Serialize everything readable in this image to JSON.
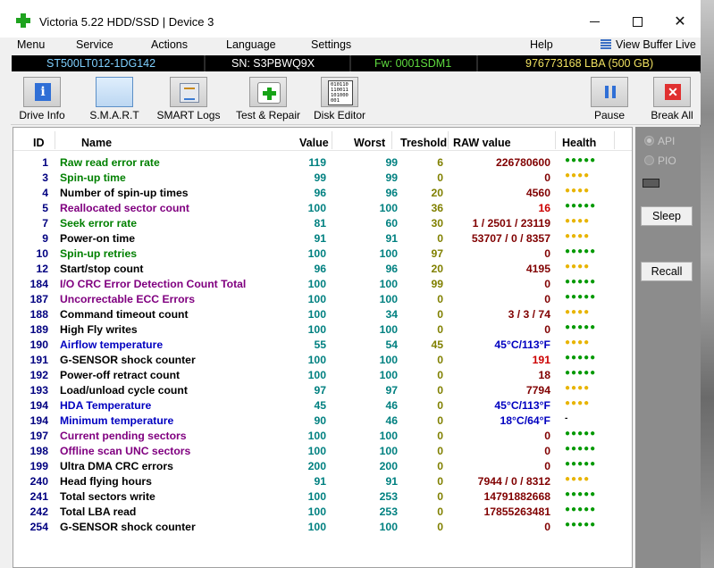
{
  "window": {
    "title": "Victoria 5.22 HDD/SSD | Device 3"
  },
  "colors": {
    "green": "#008000",
    "purple": "#800080",
    "blue": "#0000c0",
    "black": "#000000",
    "darkred": "#800000",
    "red": "#cc0000",
    "health_green": "#009900",
    "health_yellow": "#e8b400"
  },
  "menu": {
    "items": [
      "Menu",
      "Service",
      "Actions",
      "Language",
      "Settings",
      "Help"
    ],
    "view_buffer": "View Buffer Live"
  },
  "infobar": {
    "model": "ST500LT012-1DG142",
    "serial": "SN: S3PBWQ9X",
    "firmware": "Fw: 0001SDM1",
    "capacity": "976773168 LBA (500 GB)"
  },
  "toolbar": {
    "drive_info": "Drive Info",
    "smart": "S.M.A.R.T",
    "smart_logs": "SMART Logs",
    "test_repair": "Test & Repair",
    "disk_editor": "Disk Editor",
    "pause": "Pause",
    "break_all": "Break All",
    "editor_icon_text": "010110 110011 101000 001"
  },
  "table": {
    "headers": {
      "id": "ID",
      "name": "Name",
      "value": "Value",
      "worst": "Worst",
      "threshold": "Treshold",
      "raw": "RAW value",
      "health": "Health"
    },
    "rows": [
      {
        "id": "1",
        "name": "Raw read error rate",
        "name_color": "green",
        "value": "119",
        "worst": "99",
        "threshold": "6",
        "raw": "226780600",
        "raw_color": "darkred",
        "health": "●●●●●",
        "health_color": "health_green"
      },
      {
        "id": "3",
        "name": "Spin-up time",
        "name_color": "green",
        "value": "99",
        "worst": "99",
        "threshold": "0",
        "raw": "0",
        "raw_color": "darkred",
        "health": "●●●●",
        "health_color": "health_yellow"
      },
      {
        "id": "4",
        "name": "Number of spin-up times",
        "name_color": "black",
        "value": "96",
        "worst": "96",
        "threshold": "20",
        "raw": "4560",
        "raw_color": "darkred",
        "health": "●●●●",
        "health_color": "health_yellow"
      },
      {
        "id": "5",
        "name": "Reallocated sector count",
        "name_color": "purple",
        "value": "100",
        "worst": "100",
        "threshold": "36",
        "raw": "16",
        "raw_color": "red",
        "health": "●●●●●",
        "health_color": "health_green"
      },
      {
        "id": "7",
        "name": "Seek error rate",
        "name_color": "green",
        "value": "81",
        "worst": "60",
        "threshold": "30",
        "raw": "1 / 2501 / 23119",
        "raw_color": "darkred",
        "health": "●●●●",
        "health_color": "health_yellow"
      },
      {
        "id": "9",
        "name": "Power-on time",
        "name_color": "black",
        "value": "91",
        "worst": "91",
        "threshold": "0",
        "raw": "53707 / 0 / 8357",
        "raw_color": "darkred",
        "health": "●●●●",
        "health_color": "health_yellow"
      },
      {
        "id": "10",
        "name": "Spin-up retries",
        "name_color": "green",
        "value": "100",
        "worst": "100",
        "threshold": "97",
        "raw": "0",
        "raw_color": "darkred",
        "health": "●●●●●",
        "health_color": "health_green"
      },
      {
        "id": "12",
        "name": "Start/stop count",
        "name_color": "black",
        "value": "96",
        "worst": "96",
        "threshold": "20",
        "raw": "4195",
        "raw_color": "darkred",
        "health": "●●●●",
        "health_color": "health_yellow"
      },
      {
        "id": "184",
        "name": "I/O CRC Error Detection Count Total",
        "name_color": "purple",
        "value": "100",
        "worst": "100",
        "threshold": "99",
        "raw": "0",
        "raw_color": "darkred",
        "health": "●●●●●",
        "health_color": "health_green"
      },
      {
        "id": "187",
        "name": "Uncorrectable ECC Errors",
        "name_color": "purple",
        "value": "100",
        "worst": "100",
        "threshold": "0",
        "raw": "0",
        "raw_color": "darkred",
        "health": "●●●●●",
        "health_color": "health_green"
      },
      {
        "id": "188",
        "name": "Command timeout count",
        "name_color": "black",
        "value": "100",
        "worst": "34",
        "threshold": "0",
        "raw": "3 / 3 / 74",
        "raw_color": "darkred",
        "health": "●●●●",
        "health_color": "health_yellow"
      },
      {
        "id": "189",
        "name": "High Fly writes",
        "name_color": "black",
        "value": "100",
        "worst": "100",
        "threshold": "0",
        "raw": "0",
        "raw_color": "darkred",
        "health": "●●●●●",
        "health_color": "health_green"
      },
      {
        "id": "190",
        "name": "Airflow temperature",
        "name_color": "blue",
        "value": "55",
        "worst": "54",
        "threshold": "45",
        "raw": "45°C/113°F",
        "raw_color": "blue",
        "health": "●●●●",
        "health_color": "health_yellow"
      },
      {
        "id": "191",
        "name": "G-SENSOR shock counter",
        "name_color": "black",
        "value": "100",
        "worst": "100",
        "threshold": "0",
        "raw": "191",
        "raw_color": "red",
        "health": "●●●●●",
        "health_color": "health_green"
      },
      {
        "id": "192",
        "name": "Power-off retract count",
        "name_color": "black",
        "value": "100",
        "worst": "100",
        "threshold": "0",
        "raw": "18",
        "raw_color": "darkred",
        "health": "●●●●●",
        "health_color": "health_green"
      },
      {
        "id": "193",
        "name": "Load/unload cycle count",
        "name_color": "black",
        "value": "97",
        "worst": "97",
        "threshold": "0",
        "raw": "7794",
        "raw_color": "darkred",
        "health": "●●●●",
        "health_color": "health_yellow"
      },
      {
        "id": "194",
        "name": "HDA Temperature",
        "name_color": "blue",
        "value": "45",
        "worst": "46",
        "threshold": "0",
        "raw": "45°C/113°F",
        "raw_color": "blue",
        "health": "●●●●",
        "health_color": "health_yellow"
      },
      {
        "id": "194",
        "name": "Minimum temperature",
        "name_color": "blue",
        "value": "90",
        "worst": "46",
        "threshold": "0",
        "raw": "18°C/64°F",
        "raw_color": "blue",
        "health": "-",
        "health_color": "black"
      },
      {
        "id": "197",
        "name": "Current pending sectors",
        "name_color": "purple",
        "value": "100",
        "worst": "100",
        "threshold": "0",
        "raw": "0",
        "raw_color": "darkred",
        "health": "●●●●●",
        "health_color": "health_green"
      },
      {
        "id": "198",
        "name": "Offline scan UNC sectors",
        "name_color": "purple",
        "value": "100",
        "worst": "100",
        "threshold": "0",
        "raw": "0",
        "raw_color": "darkred",
        "health": "●●●●●",
        "health_color": "health_green"
      },
      {
        "id": "199",
        "name": "Ultra DMA CRC errors",
        "name_color": "black",
        "value": "200",
        "worst": "200",
        "threshold": "0",
        "raw": "0",
        "raw_color": "darkred",
        "health": "●●●●●",
        "health_color": "health_green"
      },
      {
        "id": "240",
        "name": "Head flying hours",
        "name_color": "black",
        "value": "91",
        "worst": "91",
        "threshold": "0",
        "raw": "7944 / 0 / 8312",
        "raw_color": "darkred",
        "health": "●●●●",
        "health_color": "health_yellow"
      },
      {
        "id": "241",
        "name": "Total sectors write",
        "name_color": "black",
        "value": "100",
        "worst": "253",
        "threshold": "0",
        "raw": "14791882668",
        "raw_color": "darkred",
        "health": "●●●●●",
        "health_color": "health_green"
      },
      {
        "id": "242",
        "name": "Total LBA read",
        "name_color": "black",
        "value": "100",
        "worst": "253",
        "threshold": "0",
        "raw": "17855263481",
        "raw_color": "darkred",
        "health": "●●●●●",
        "health_color": "health_green"
      },
      {
        "id": "254",
        "name": "G-SENSOR shock counter",
        "name_color": "black",
        "value": "100",
        "worst": "100",
        "threshold": "0",
        "raw": "0",
        "raw_color": "darkred",
        "health": "●●●●●",
        "health_color": "health_green"
      }
    ]
  },
  "side": {
    "api": "API",
    "pio": "PIO",
    "sleep": "Sleep",
    "recall": "Recall"
  }
}
